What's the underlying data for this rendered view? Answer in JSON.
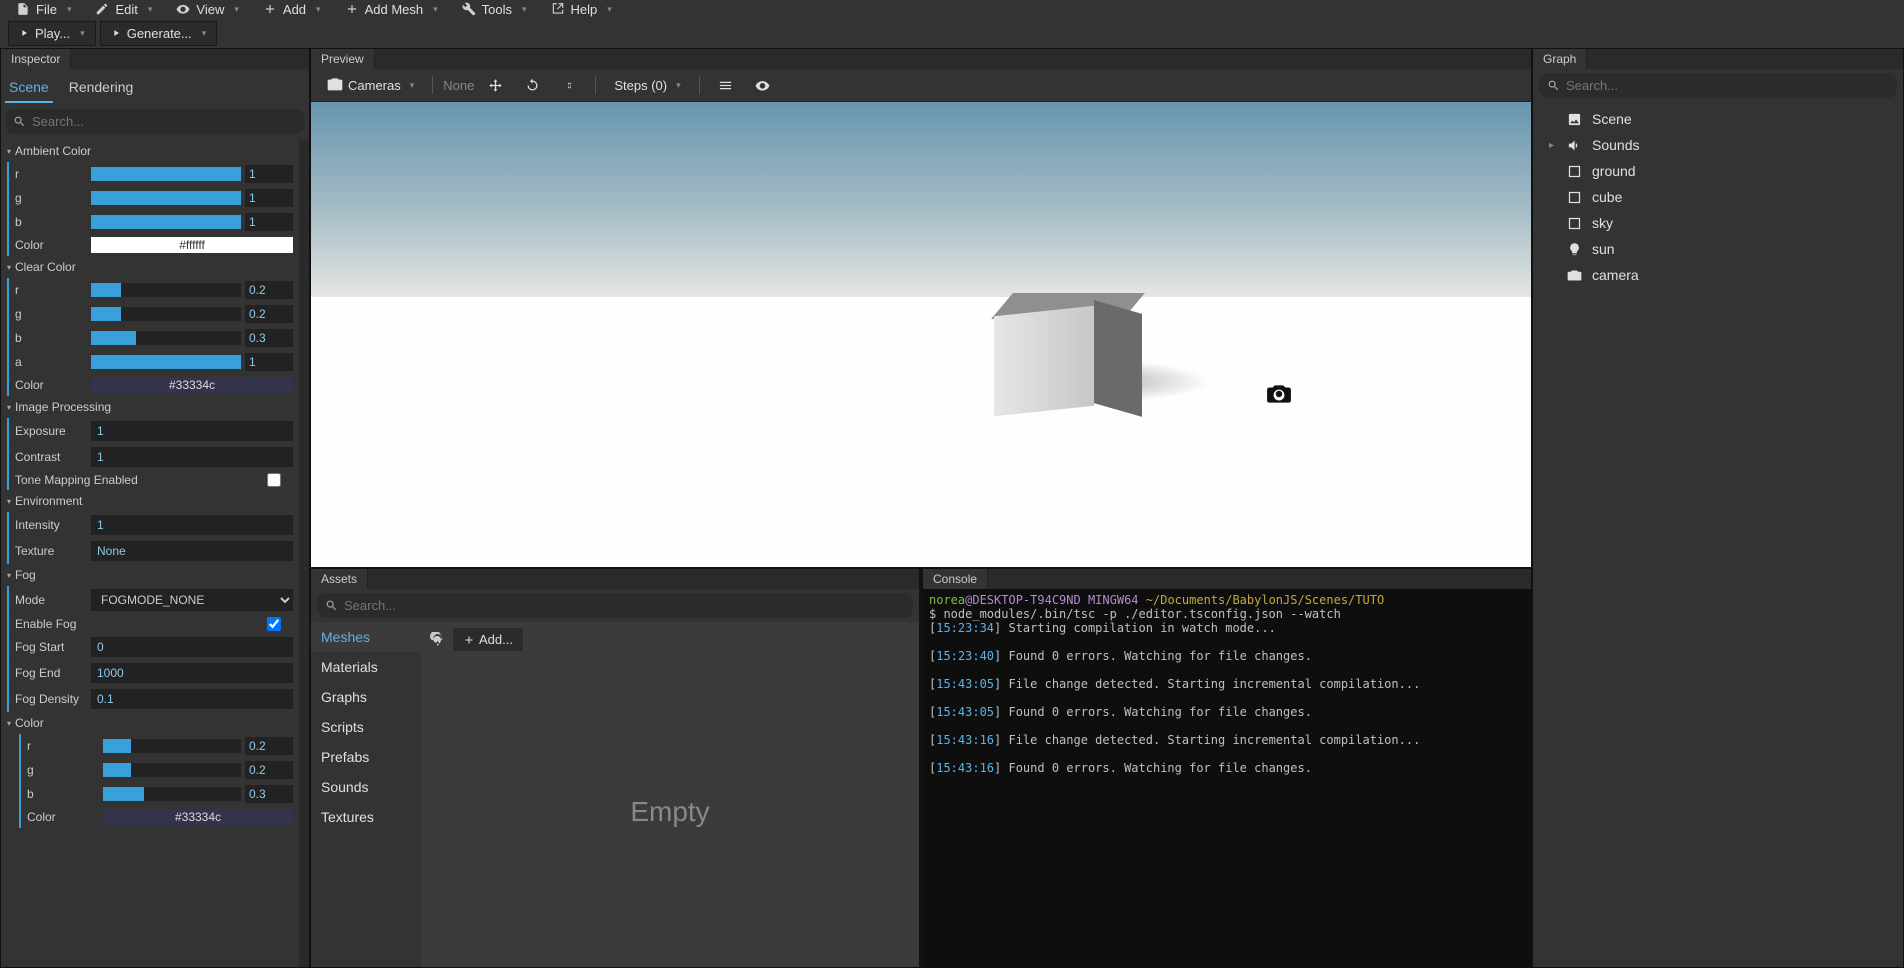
{
  "menubar": {
    "items": [
      {
        "label": "File",
        "icon": "file"
      },
      {
        "label": "Edit",
        "icon": "edit"
      },
      {
        "label": "View",
        "icon": "view"
      },
      {
        "label": "Add",
        "icon": "add"
      },
      {
        "label": "Add Mesh",
        "icon": "add"
      },
      {
        "label": "Tools",
        "icon": "tools"
      },
      {
        "label": "Help",
        "icon": "help"
      }
    ]
  },
  "toolbar": {
    "play_label": "Play...",
    "generate_label": "Generate..."
  },
  "inspector": {
    "tab_title": "Inspector",
    "subtabs": {
      "scene": "Scene",
      "rendering": "Rendering"
    },
    "search_placeholder": "Search...",
    "sections": {
      "ambient": {
        "title": "Ambient Color",
        "r": {
          "label": "r",
          "value": "1",
          "fill": 100
        },
        "g": {
          "label": "g",
          "value": "1",
          "fill": 100
        },
        "b": {
          "label": "b",
          "value": "1",
          "fill": 100
        },
        "color_label": "Color",
        "color_hex": "#ffffff"
      },
      "clear": {
        "title": "Clear Color",
        "r": {
          "label": "r",
          "value": "0.2",
          "fill": 20
        },
        "g": {
          "label": "g",
          "value": "0.2",
          "fill": 20
        },
        "b": {
          "label": "b",
          "value": "0.3",
          "fill": 30
        },
        "a": {
          "label": "a",
          "value": "1",
          "fill": 100
        },
        "color_label": "Color",
        "color_hex": "#33334c"
      },
      "image_proc": {
        "title": "Image Processing",
        "exposure_label": "Exposure",
        "exposure_value": "1",
        "contrast_label": "Contrast",
        "contrast_value": "1",
        "tone_label": "Tone Mapping Enabled",
        "tone_checked": false
      },
      "env": {
        "title": "Environment",
        "intensity_label": "Intensity",
        "intensity_value": "1",
        "texture_label": "Texture",
        "texture_value": "None"
      },
      "fog": {
        "title": "Fog",
        "mode_label": "Mode",
        "mode_value": "FOGMODE_NONE",
        "enable_label": "Enable Fog",
        "enable_checked": true,
        "start_label": "Fog Start",
        "start_value": "0",
        "end_label": "Fog End",
        "end_value": "1000",
        "density_label": "Fog Density",
        "density_value": "0.1"
      },
      "fog_color": {
        "title": "Color",
        "r": {
          "label": "r",
          "value": "0.2",
          "fill": 20
        },
        "g": {
          "label": "g",
          "value": "0.2",
          "fill": 20
        },
        "b": {
          "label": "b",
          "value": "0.3",
          "fill": 30
        },
        "color_label": "Color",
        "color_hex": "#33334c"
      }
    }
  },
  "preview": {
    "tab_title": "Preview",
    "cameras_label": "Cameras",
    "none_label": "None",
    "steps_label": "Steps (0)"
  },
  "assets": {
    "tab_title": "Assets",
    "search_placeholder": "Search...",
    "add_label": "Add...",
    "empty_label": "Empty",
    "categories": [
      "Meshes",
      "Materials",
      "Graphs",
      "Scripts",
      "Prefabs",
      "Sounds",
      "Textures"
    ]
  },
  "console": {
    "tab_title": "Console",
    "user": "norea",
    "host": "@DESKTOP-T94C9ND",
    "shell": "MINGW64",
    "path": "~/Documents/BabylonJS/Scenes/TUTO",
    "cmd": "$ node_modules/.bin/tsc -p ./editor.tsconfig.json --watch",
    "lines": [
      {
        "time": "15:23:34",
        "msg": "Starting compilation in watch mode..."
      },
      {
        "time": "15:23:40",
        "msg": "Found 0 errors. Watching for file changes."
      },
      {
        "time": "15:43:05",
        "msg": "File change detected. Starting incremental compilation..."
      },
      {
        "time": "15:43:05",
        "msg": "Found 0 errors. Watching for file changes."
      },
      {
        "time": "15:43:16",
        "msg": "File change detected. Starting incremental compilation..."
      },
      {
        "time": "15:43:16",
        "msg": "Found 0 errors. Watching for file changes."
      }
    ]
  },
  "graph": {
    "tab_title": "Graph",
    "search_placeholder": "Search...",
    "items": [
      {
        "label": "Scene",
        "icon": "image",
        "expand": false
      },
      {
        "label": "Sounds",
        "icon": "sound",
        "expand": true
      },
      {
        "label": "ground",
        "icon": "mesh",
        "expand": false
      },
      {
        "label": "cube",
        "icon": "mesh",
        "expand": false
      },
      {
        "label": "sky",
        "icon": "mesh",
        "expand": false
      },
      {
        "label": "sun",
        "icon": "light",
        "expand": false
      },
      {
        "label": "camera",
        "icon": "camera",
        "expand": false
      }
    ]
  }
}
